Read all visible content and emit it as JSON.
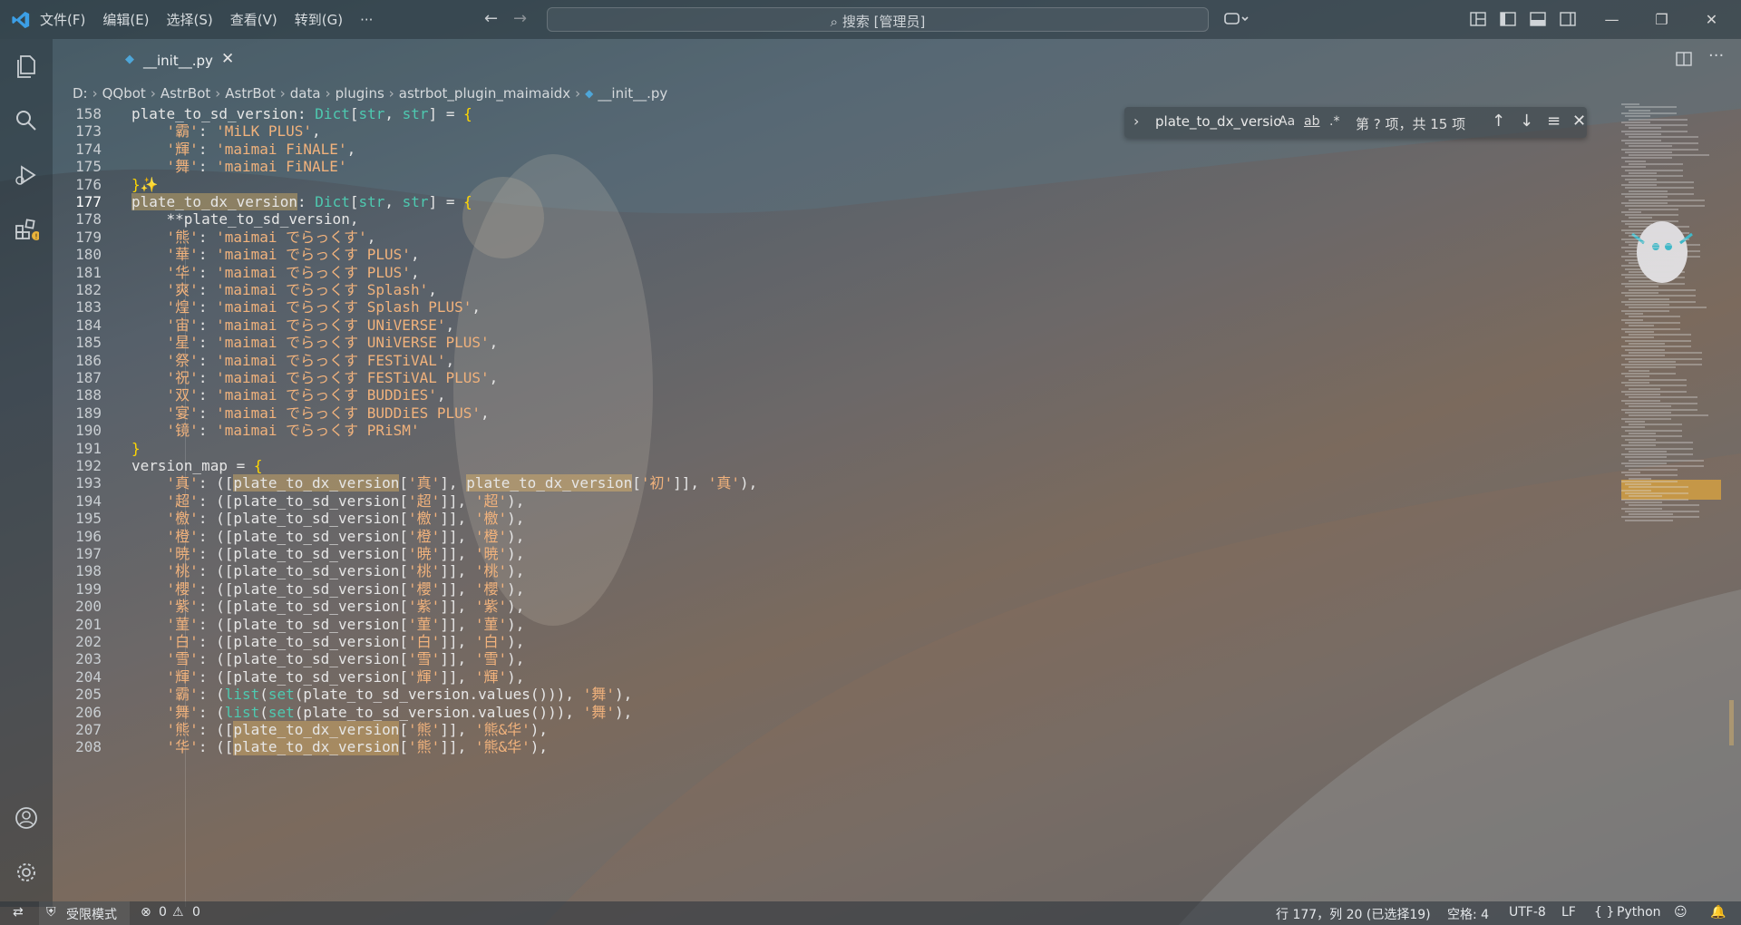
{
  "menu": [
    "文件(F)",
    "编辑(E)",
    "选择(S)",
    "查看(V)",
    "转到(G)",
    "···"
  ],
  "search": {
    "label": "搜索 [管理员]"
  },
  "tab": {
    "label": "__init__.py",
    "close": "✕"
  },
  "breadcrumb": [
    "D:",
    "QQbot",
    "AstrBot",
    "AstrBot",
    "data",
    "plugins",
    "astrbot_plugin_maimaidx",
    "__init__.py"
  ],
  "find": {
    "query": "plate_to_dx_versio",
    "match_case": "Aa",
    "whole_word": "ab",
    "regex": ".*",
    "count": "第 ? 项，共 15 项"
  },
  "code_lines": [
    {
      "n": "158",
      "text": "plate_to_sd_version: Dict[str, str] = {"
    },
    {
      "n": "173",
      "text": "    '霸': 'MiLK PLUS',"
    },
    {
      "n": "174",
      "text": "    '輝': 'maimai FiNALE',"
    },
    {
      "n": "175",
      "text": "    '舞': 'maimai FiNALE'"
    },
    {
      "n": "176",
      "text": "}✨"
    },
    {
      "n": "177",
      "text": "plate_to_dx_version: Dict[str, str] = {"
    },
    {
      "n": "178",
      "text": "    **plate_to_sd_version,"
    },
    {
      "n": "179",
      "text": "    '熊': 'maimai でらっくす',"
    },
    {
      "n": "180",
      "text": "    '華': 'maimai でらっくす PLUS',"
    },
    {
      "n": "181",
      "text": "    '华': 'maimai でらっくす PLUS',"
    },
    {
      "n": "182",
      "text": "    '爽': 'maimai でらっくす Splash',"
    },
    {
      "n": "183",
      "text": "    '煌': 'maimai でらっくす Splash PLUS',"
    },
    {
      "n": "184",
      "text": "    '宙': 'maimai でらっくす UNiVERSE',"
    },
    {
      "n": "185",
      "text": "    '星': 'maimai でらっくす UNiVERSE PLUS',"
    },
    {
      "n": "186",
      "text": "    '祭': 'maimai でらっくす FESTiVAL',"
    },
    {
      "n": "187",
      "text": "    '祝': 'maimai でらっくす FESTiVAL PLUS',"
    },
    {
      "n": "188",
      "text": "    '双': 'maimai でらっくす BUDDiES',"
    },
    {
      "n": "189",
      "text": "    '宴': 'maimai でらっくす BUDDiES PLUS',"
    },
    {
      "n": "190",
      "text": "    '镜': 'maimai でらっくす PRiSM'"
    },
    {
      "n": "191",
      "text": "}"
    },
    {
      "n": "192",
      "text": "version_map = {"
    },
    {
      "n": "193",
      "text": "    '真': ([plate_to_dx_version['真'], plate_to_dx_version['初']], '真'),"
    },
    {
      "n": "194",
      "text": "    '超': ([plate_to_sd_version['超']], '超'),"
    },
    {
      "n": "195",
      "text": "    '檄': ([plate_to_sd_version['檄']], '檄'),"
    },
    {
      "n": "196",
      "text": "    '橙': ([plate_to_sd_version['橙']], '橙'),"
    },
    {
      "n": "197",
      "text": "    '暁': ([plate_to_sd_version['暁']], '暁'),"
    },
    {
      "n": "198",
      "text": "    '桃': ([plate_to_sd_version['桃']], '桃'),"
    },
    {
      "n": "199",
      "text": "    '櫻': ([plate_to_sd_version['櫻']], '櫻'),"
    },
    {
      "n": "200",
      "text": "    '紫': ([plate_to_sd_version['紫']], '紫'),"
    },
    {
      "n": "201",
      "text": "    '菫': ([plate_to_sd_version['菫']], '菫'),"
    },
    {
      "n": "202",
      "text": "    '白': ([plate_to_sd_version['白']], '白'),"
    },
    {
      "n": "203",
      "text": "    '雪': ([plate_to_sd_version['雪']], '雪'),"
    },
    {
      "n": "204",
      "text": "    '輝': ([plate_to_sd_version['輝']], '輝'),"
    },
    {
      "n": "205",
      "text": "    '霸': (list(set(plate_to_sd_version.values())), '舞'),"
    },
    {
      "n": "206",
      "text": "    '舞': (list(set(plate_to_sd_version.values())), '舞'),"
    },
    {
      "n": "207",
      "text": "    '熊': ([plate_to_dx_version['熊']], '熊&华'),"
    },
    {
      "n": "208",
      "text": "    '华': ([plate_to_dx_version['熊']], '熊&华'),"
    }
  ],
  "status": {
    "mode": "受限模式",
    "errors": "0",
    "warnings": "0",
    "position": "行 177，列 20 (已选择19)",
    "spaces": "空格: 4",
    "encoding": "UTF-8",
    "eol": "LF",
    "language": "Python"
  },
  "colors": {
    "accent": "#f6d36e",
    "string": "#f1b27c",
    "type": "#4ec9b0",
    "highlight": "#ffc864"
  }
}
